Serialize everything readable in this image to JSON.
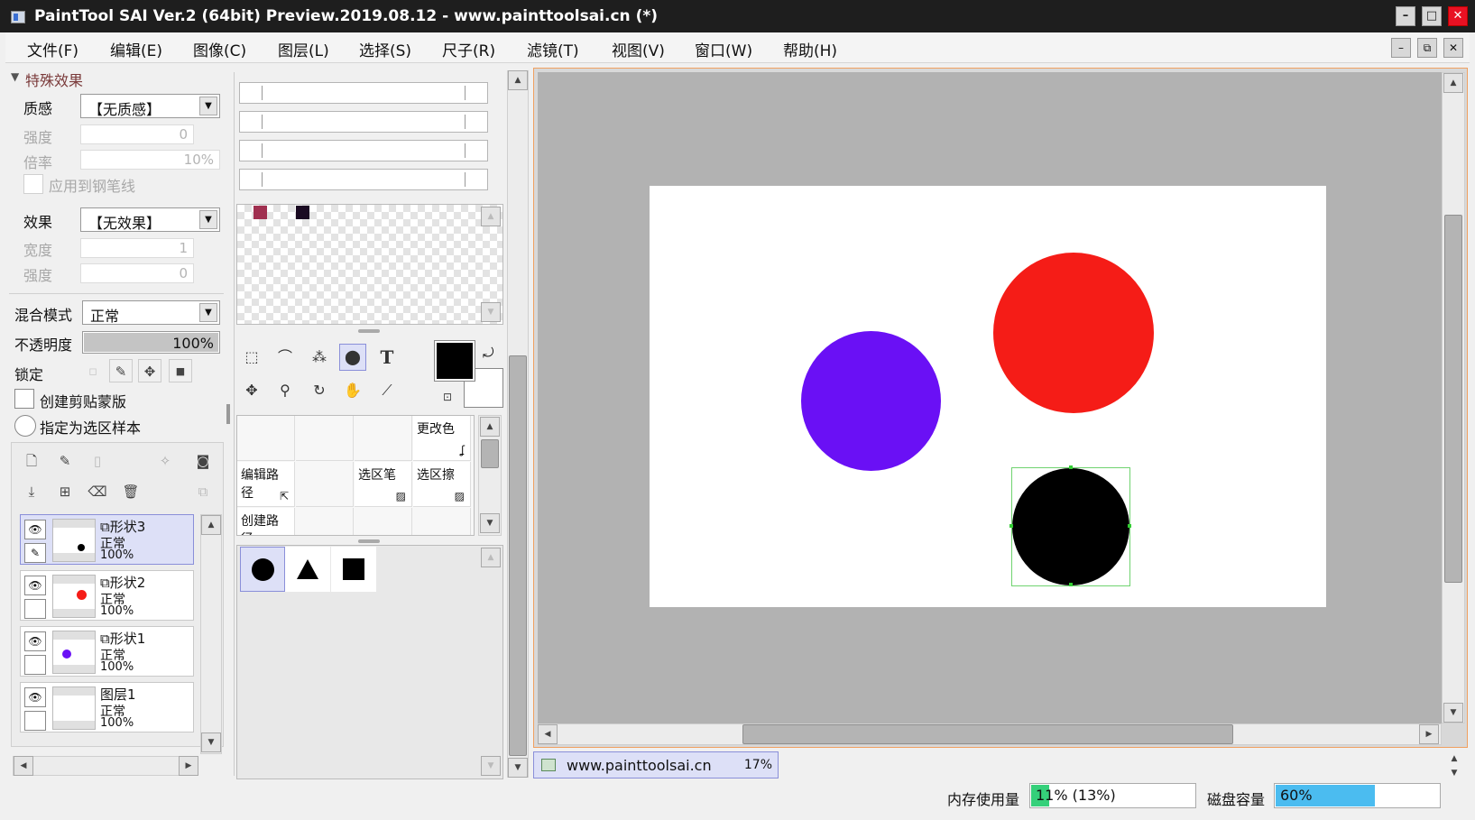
{
  "titlebar": {
    "title": "PaintTool SAI Ver.2 (64bit) Preview.2019.08.12 - www.painttoolsai.cn (*)",
    "minimize": "–",
    "maximize": "□",
    "close": "✕"
  },
  "menu": [
    "文件(F)",
    "编辑(E)",
    "图像(C)",
    "图层(L)",
    "选择(S)",
    "尺子(R)",
    "滤镜(T)",
    "视图(V)",
    "窗口(W)",
    "帮助(H)"
  ],
  "mdi": {
    "minimize": "–",
    "restore": "⧉",
    "close": "✕"
  },
  "effects": {
    "header": "特殊效果",
    "texture_label": "质感",
    "texture_value": "【无质感】",
    "strength_label": "强度",
    "strength_value": "0",
    "scale_label": "倍率",
    "scale_value": "10%",
    "apply_pen_label": "应用到钢笔线",
    "effect_label": "效果",
    "effect_value": "【无效果】",
    "width_label": "宽度",
    "width_value": "1",
    "strength2_label": "强度",
    "strength2_value": "0"
  },
  "layer_props": {
    "blend_label": "混合模式",
    "blend_value": "正常",
    "opacity_label": "不透明度",
    "opacity_value": "100%",
    "opacity_fraction": 1.0,
    "lock_label": "锁定",
    "clip_label": "创建剪贴蒙版",
    "selsrc_label": "指定为选区样本"
  },
  "layers": [
    {
      "name": "形状3",
      "mode": "正常",
      "opacity": "100%",
      "selected": true,
      "dot_color": "#000000",
      "shape": true
    },
    {
      "name": "形状2",
      "mode": "正常",
      "opacity": "100%",
      "selected": false,
      "dot_color": "#f51c17",
      "shape": true
    },
    {
      "name": "形状1",
      "mode": "正常",
      "opacity": "100%",
      "selected": false,
      "dot_color": "#6a10f5",
      "shape": true
    },
    {
      "name": "图层1",
      "mode": "正常",
      "opacity": "100%",
      "selected": false,
      "dot_color": "",
      "shape": false
    }
  ],
  "swatches": [
    "#a03050",
    "#1a0a22"
  ],
  "colors": {
    "primary": "#000000",
    "secondary": "#ffffff"
  },
  "tools": {
    "text_tool": "T"
  },
  "path_tools": {
    "change_color": "更改色",
    "edit_path": "编辑路径",
    "sel_pen": "选区笔",
    "sel_eraser": "选区擦",
    "create_path": "创建路径"
  },
  "shapes": [
    "circle",
    "triangle",
    "square"
  ],
  "canvas_objects": [
    {
      "name": "red-circle",
      "color": "#f51c17"
    },
    {
      "name": "purple-circle",
      "color": "#6a10f5"
    },
    {
      "name": "black-circle",
      "color": "#000000"
    }
  ],
  "doc_tab": {
    "name": "www.painttoolsai.cn",
    "zoom": "17%"
  },
  "status": {
    "memory_label": "内存使用量",
    "memory_value": "11% (13%)",
    "memory_fraction": 0.11,
    "disk_label": "磁盘容量",
    "disk_value": "60%",
    "disk_fraction": 0.6
  }
}
